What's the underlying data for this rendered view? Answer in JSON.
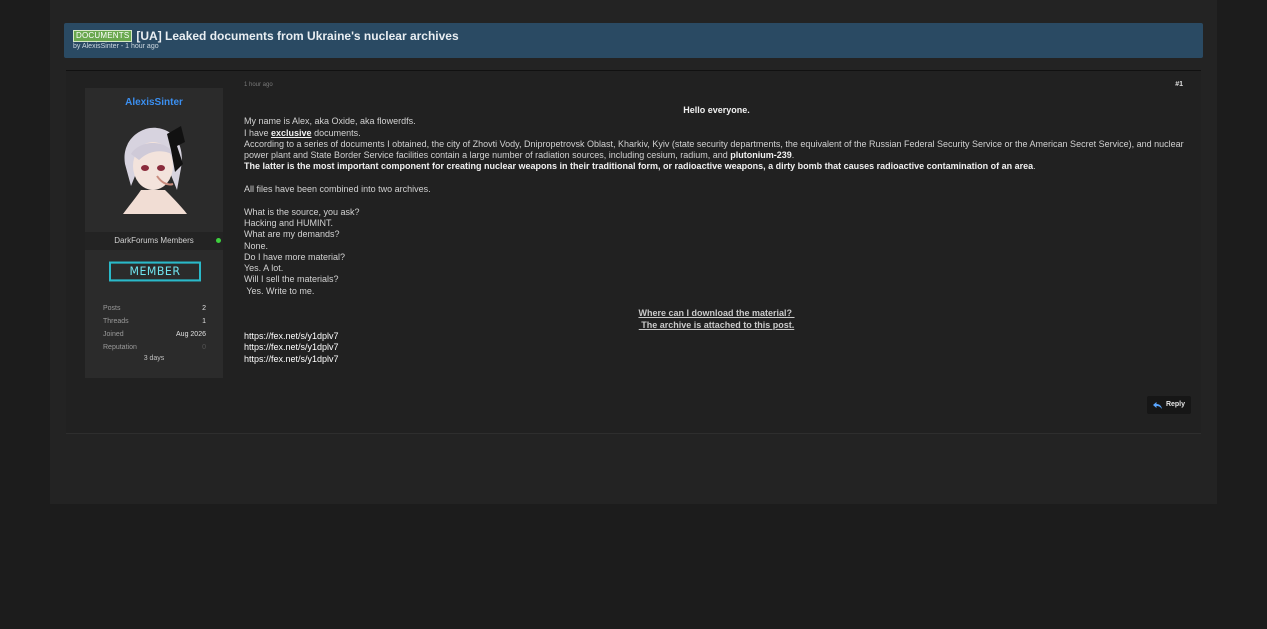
{
  "thread": {
    "prefix": "DOCUMENTS",
    "title": "[UA] Leaked documents from Ukraine's nuclear archives",
    "byline": "by AlexisSinter - 1 hour ago"
  },
  "user": {
    "name": "AlexisSinter",
    "group": "DarkForums Members",
    "badge": "MEMBER",
    "stats": [
      {
        "label": "Posts",
        "value": "2"
      },
      {
        "label": "Threads",
        "value": "1"
      },
      {
        "label": "Joined",
        "value": "Aug 2026"
      },
      {
        "label": "Reputation",
        "value": "0"
      }
    ],
    "rep_note": "3 days"
  },
  "post": {
    "date": "1 hour ago",
    "number": "#1",
    "greeting": "Hello everyone.",
    "line1": "My name is Alex, aka Oxide, aka flowerdfs.",
    "line2_a": "I have ",
    "line2_b": "exclusive",
    "line2_c": " documents.",
    "para_a": "According to a series of documents I obtained, the city of Zhovti Vody, Dnipropetrovsk Oblast, Kharkiv, Kyiv (state security departments, the equivalent of the Russian Federal Security Service or the American Secret Service), and nuclear power plant and State Border Service facilities contain a large number of radiation sources, including cesium, radium, and ",
    "para_b": "plutonium-239",
    "para_c": ".",
    "bold_line": "The latter is the most important component for creating nuclear weapons in their traditional form, or radioactive weapons, a dirty bomb that causes radioactive contamination of an area",
    "bold_end": ".",
    "archives": "All files have been combined into two archives.",
    "qa": [
      "What is the source, you ask?",
      "Hacking and HUMINT.",
      "What are my demands?",
      "None.",
      "Do I have more material?",
      "Yes. A lot.",
      "Will I sell the materials?",
      " Yes. Write to me."
    ],
    "download_q": "Where can I download the material? ",
    "download_a": " The archive is attached to this post.",
    "links": [
      "https://fex.net/s/y1dplv7",
      "https://fex.net/s/y1dplv7",
      "https://fex.net/s/y1dplv7"
    ],
    "reply_label": "Reply"
  }
}
